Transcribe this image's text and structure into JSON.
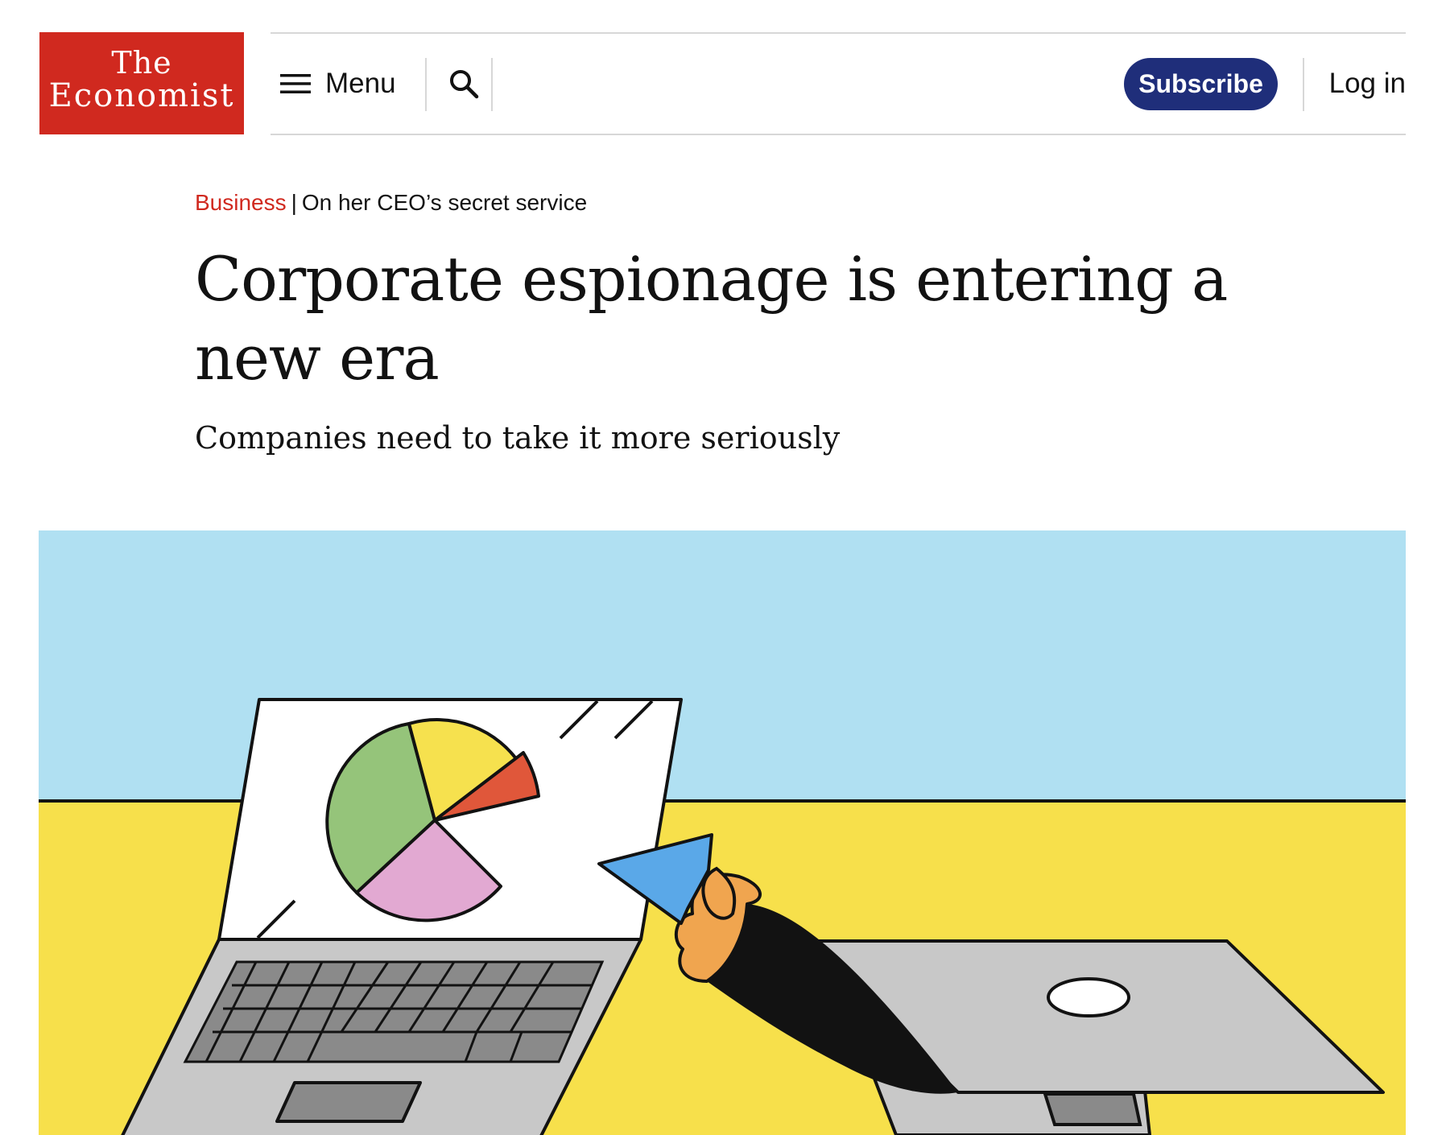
{
  "header": {
    "logo": {
      "line1": "The",
      "line2": "Economist"
    },
    "menu_label": "Menu",
    "subscribe_label": "Subscribe",
    "login_label": "Log in",
    "icons": [
      "menu-icon",
      "search-icon"
    ]
  },
  "article": {
    "section": "Business",
    "separator": "|",
    "rubric": "On her CEO’s secret service",
    "headline": "Corporate espionage is entering a new era",
    "subheadline": "Companies need to take it more seriously"
  },
  "colors": {
    "brand_red": "#d0291f",
    "subscribe_navy": "#1f2e7a",
    "sky_blue": "#b0e0f2",
    "desk_yellow": "#f7e04b",
    "laptop_grey": "#c8c8c8",
    "pie_green": "#95c47a",
    "pie_yellow": "#f6e14e",
    "pie_orange": "#e0573a",
    "pie_pink": "#e2a9d2",
    "hand_skin": "#f0a54f",
    "chip_blue": "#5aa8e8"
  }
}
